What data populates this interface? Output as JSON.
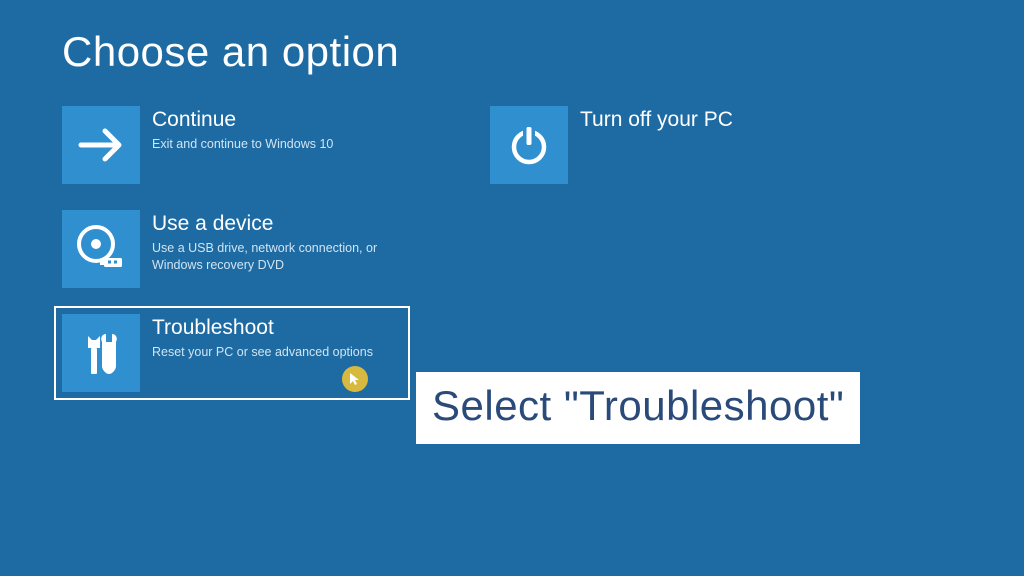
{
  "title": "Choose an option",
  "tiles": {
    "continue": {
      "title": "Continue",
      "desc": "Exit and continue to Windows 10"
    },
    "poweroff": {
      "title": "Turn off your PC",
      "desc": ""
    },
    "usedevice": {
      "title": "Use a device",
      "desc": "Use a USB drive, network connection, or Windows recovery DVD"
    },
    "troubleshoot": {
      "title": "Troubleshoot",
      "desc": "Reset your PC or see advanced options"
    }
  },
  "annotation": "Select \"Troubleshoot\"",
  "colors": {
    "bg": "#1e6ba3",
    "tile": "#2f8fcf",
    "annotation_bg": "#ffffff",
    "annotation_fg": "#2a4a7a"
  }
}
